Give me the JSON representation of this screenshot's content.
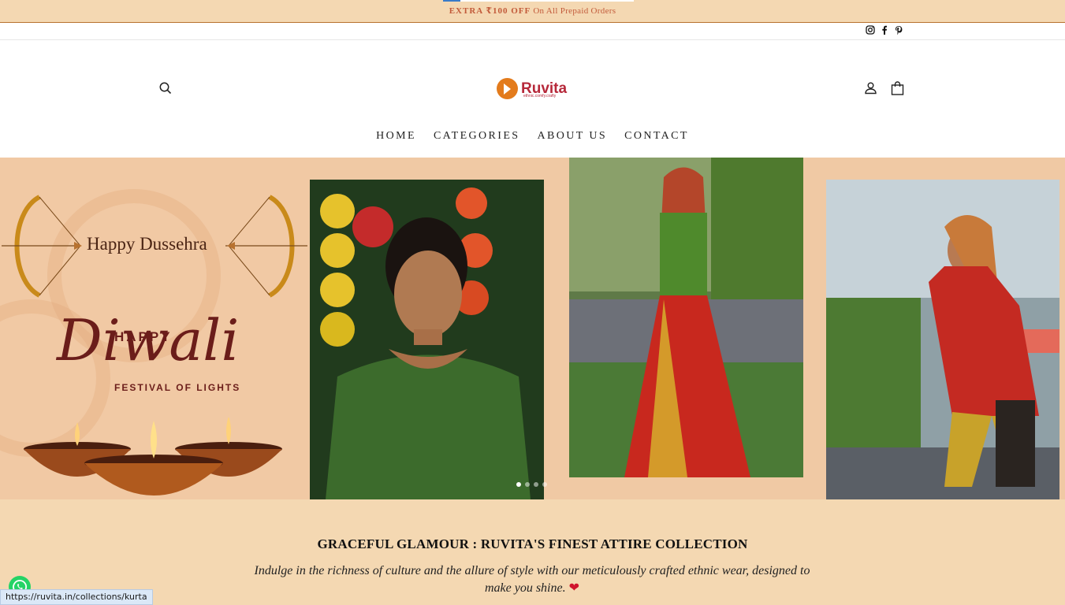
{
  "announcement": {
    "highlight": "EXTRA ₹100 OFF",
    "text": "On All Prepaid Orders"
  },
  "social": {
    "icons": [
      "instagram-icon",
      "facebook-icon",
      "pinterest-icon"
    ]
  },
  "header": {
    "logo_name": "Ruvita",
    "logo_tagline": "ethnic.comfy.crafty"
  },
  "nav": {
    "items": [
      "HOME",
      "CATEGORIES",
      "ABOUT US",
      "CONTACT"
    ]
  },
  "hero": {
    "dussehra": "Happy Dussehra",
    "happy": "HAPPY",
    "diwali": "Diwali",
    "festival": "FESTIVAL OF LIGHTS",
    "slide_count": 4,
    "active_slide": 1
  },
  "intro": {
    "title": "GRACEFUL GLAMOUR : RUVITA'S FINEST ATTIRE COLLECTION",
    "text": "Indulge in the richness of culture and the allure of style with our meticulously crafted ethnic wear, designed to make you shine."
  },
  "status_bar": {
    "url": "https://ruvita.in/collections/kurta"
  },
  "colors": {
    "accent": "#f4d8b2",
    "brand": "#b6283a",
    "logo_orange": "#e37b1c"
  }
}
